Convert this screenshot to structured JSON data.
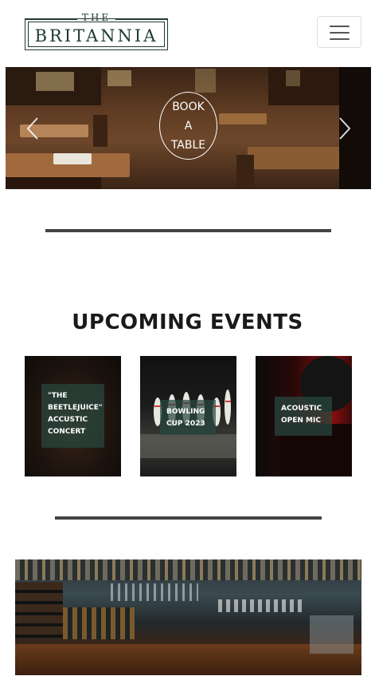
{
  "header": {
    "logo_top": "THE",
    "logo_word": "BRITANNIA",
    "menu_icon": "hamburger-icon"
  },
  "hero": {
    "book_lines": [
      "BOOK",
      "A",
      "TABLE"
    ],
    "prev_icon": "chevron-left-icon",
    "next_icon": "chevron-right-icon"
  },
  "events": {
    "title": "UPCOMING EVENTS",
    "cards": [
      {
        "label": "\"THE BEETLEJUICE\" ACCUSTIC CONCERT"
      },
      {
        "label": "BOWLING CUP 2023"
      },
      {
        "label": "ACOUSTIC OPEN MIC"
      }
    ]
  },
  "colors": {
    "brand_green": "#1f3a33",
    "rule_gray": "#444444",
    "label_overlay": "#284840"
  }
}
